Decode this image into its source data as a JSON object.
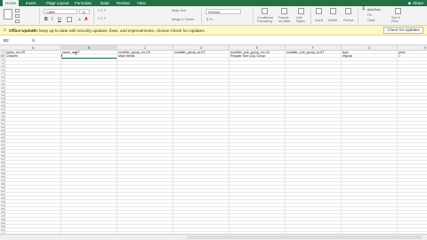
{
  "ribbon": {
    "tabs": [
      "Home",
      "Insert",
      "Page Layout",
      "Formulas",
      "Data",
      "Review",
      "View"
    ],
    "share_label": "Share",
    "font_name": "Calibri",
    "font_size": "12",
    "labels": {
      "wrap_text": "Wrap Text",
      "merge_center": "Merge & Center",
      "number_format": "General",
      "conditional_formatting": "Conditional Formatting",
      "format_as_table": "Format as Table",
      "cell_styles": "Cell Styles",
      "insert": "Insert",
      "delete": "Delete",
      "format": "Format",
      "autosum": "AutoSum",
      "fill": "Fill",
      "clear": "Clear",
      "sort_filter": "Sort & Filter"
    }
  },
  "update_bar": {
    "title": "Office Update",
    "message": "To keep up-to-date with security updates, fixes, and improvements, choose Check for Updates.",
    "button": "Check for Updates"
  },
  "formula_bar": {
    "name_box": "B2",
    "fx": "fx"
  },
  "sheet": {
    "columns": [
      "A",
      "B",
      "C",
      "D",
      "E",
      "F",
      "G",
      "H",
      "I"
    ],
    "selected_column": "B",
    "selected_row": 2,
    "row_count": 51,
    "headers": [
      "name_en-US",
      "name_ar-KT",
      "modifier_group_en-US",
      "modifier_group_ar-KT",
      "modifier_sub_group_en-US",
      "modifier_sub_group_ar-KT",
      "type",
      "price"
    ],
    "row2": [
      "Chicken",
      "",
      "Main Meals",
      "",
      "Regular Size (L&) Group",
      "",
      "regular",
      "1"
    ]
  }
}
